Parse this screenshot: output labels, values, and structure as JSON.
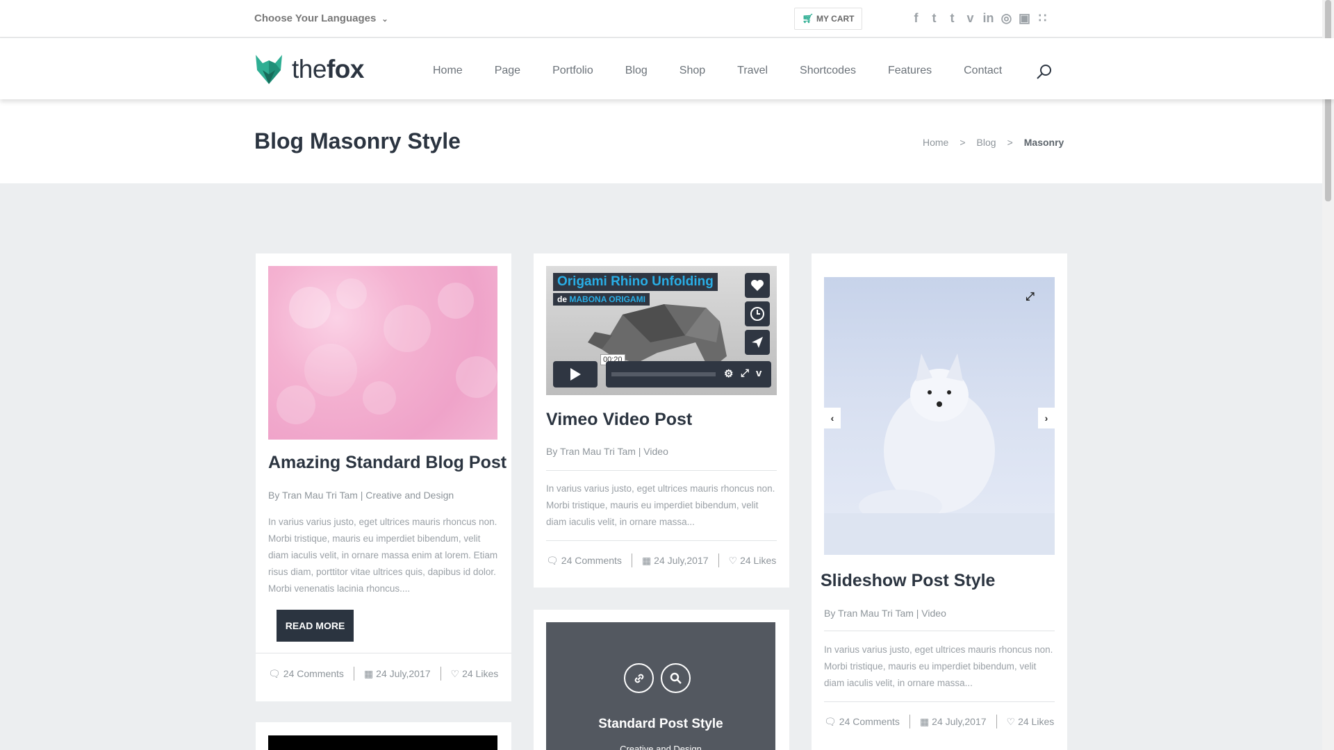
{
  "topbar": {
    "language_label": "Choose Your Languages",
    "cart_label": "MY CART",
    "social_icons": [
      "facebook-icon",
      "twitter-icon",
      "tumblr-icon",
      "vimeo-icon",
      "linkedin-icon",
      "dribbble-icon",
      "instagram-icon",
      "rss-icon"
    ]
  },
  "header": {
    "logo_light": "the",
    "logo_bold": "fox",
    "nav": [
      "Home",
      "Page",
      "Portfolio",
      "Blog",
      "Shop",
      "Travel",
      "Shortcodes",
      "Features",
      "Contact"
    ]
  },
  "titlebar": {
    "title": "Blog Masonry Style",
    "breadcrumb": [
      "Home",
      ">",
      "Blog",
      ">",
      "Masonry"
    ]
  },
  "posts": [
    {
      "title": "Amazing Standard Blog Post",
      "meta": "By Tran Mau Tri Tam | Creative and Design",
      "excerpt": "In varius varius justo, eget ultrices mauris rhoncus non. Morbi tristique, mauris eu imperdiet bibendum, velit diam iaculis velit, in ornare massa enim at lorem. Etiam risus diam, porttitor vitae ultrices quis, dapibus id dolor. Morbi venenatis lacinia rhoncus....",
      "read_more": "READ MORE",
      "comments": "24 Comments",
      "date": "24 July,2017",
      "likes": "24 Likes"
    },
    {
      "title": "Vimeo Video Post",
      "meta": "By Tran Mau Tri Tam | Video",
      "excerpt": "In varius varius justo, eget ultrices mauris rhoncus non. Morbi tristique, mauris eu imperdiet bibendum, velit diam iaculis velit, in ornare massa...",
      "comments": "24 Comments",
      "date": "24 July,2017",
      "likes": "24 Likes",
      "video_title": "Origami Rhino Unfolding",
      "video_by": "de",
      "video_author": "MABONA ORIGAMI",
      "video_time": "00:20"
    },
    {
      "title": "Slideshow Post Style",
      "meta": "By Tran Mau Tri Tam | Video",
      "excerpt": "In varius varius justo, eget ultrices mauris rhoncus non. Morbi tristique, mauris eu imperdiet bibendum, velit diam iaculis velit, in ornare massa...",
      "comments": "24 Comments",
      "date": "24 July,2017",
      "likes": "24 Likes"
    },
    {
      "title": "Standard Post Style",
      "meta": "Creative and Design"
    }
  ],
  "colors": {
    "accent": "#2eae93",
    "dark": "#2b3440",
    "background": "#eceef0"
  }
}
